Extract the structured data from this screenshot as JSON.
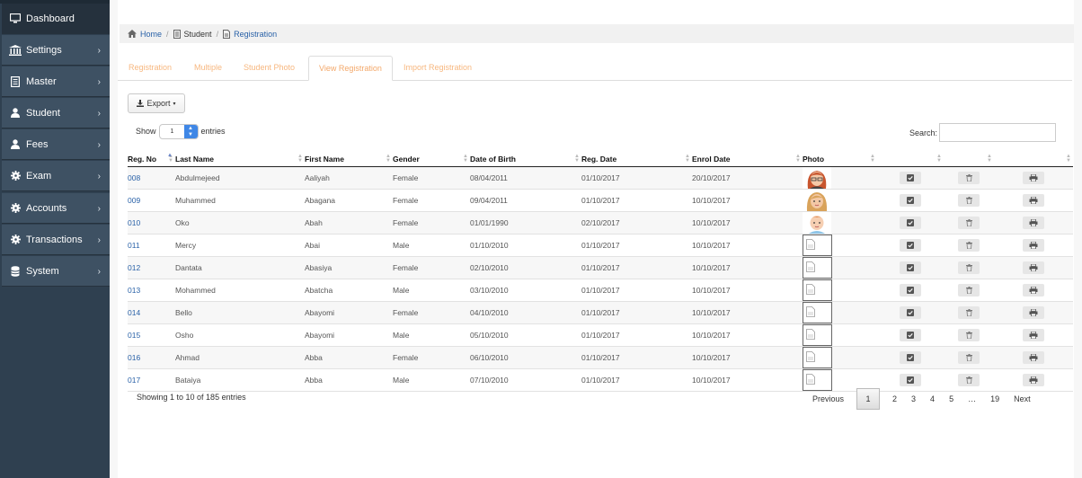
{
  "sidebar": {
    "items": [
      {
        "label": "Dashboard",
        "icon": "monitor-icon",
        "active": true
      },
      {
        "label": "Settings",
        "icon": "bank-icon"
      },
      {
        "label": "Master",
        "icon": "document-icon"
      },
      {
        "label": "Student",
        "icon": "user-icon"
      },
      {
        "label": "Fees",
        "icon": "users-icon"
      },
      {
        "label": "Exam",
        "icon": "gear-icon"
      },
      {
        "label": "Accounts",
        "icon": "gear-icon"
      },
      {
        "label": "Transactions",
        "icon": "gear-icon"
      },
      {
        "label": "System",
        "icon": "database-icon"
      }
    ]
  },
  "breadcrumb": {
    "home": "Home",
    "student": "Student",
    "registration": "Registration"
  },
  "tabs": [
    "Registration",
    "Multiple",
    "Student Photo",
    "View Registration",
    "Import Registration"
  ],
  "toolbar": {
    "export_label": "Export"
  },
  "length": {
    "show": "Show",
    "value": "1",
    "entries": "entries"
  },
  "search": {
    "label": "Search:",
    "value": ""
  },
  "table": {
    "columns": [
      "Reg. No",
      "Last Name",
      "First Name",
      "Gender",
      "Date of Birth",
      "Reg. Date",
      "Enrol Date",
      "Photo"
    ],
    "rows": [
      {
        "reg": "008",
        "last": "Abdulmejeed",
        "first": "Aaliyah",
        "gender": "Female",
        "dob": "08/04/2011",
        "regdate": "01/10/2017",
        "enrol": "20/10/2017",
        "photo": "avatar-red-hair"
      },
      {
        "reg": "009",
        "last": "Muhammed",
        "first": "Abagana",
        "gender": "Female",
        "dob": "09/04/2011",
        "regdate": "01/10/2017",
        "enrol": "10/10/2017",
        "photo": "avatar-blonde"
      },
      {
        "reg": "010",
        "last": "Oko",
        "first": "Abah",
        "gender": "Female",
        "dob": "01/01/1990",
        "regdate": "02/10/2017",
        "enrol": "10/10/2017",
        "photo": "avatar-boy"
      },
      {
        "reg": "011",
        "last": "Mercy",
        "first": "Abai",
        "gender": "Male",
        "dob": "01/10/2010",
        "regdate": "01/10/2017",
        "enrol": "10/10/2017",
        "photo": "none"
      },
      {
        "reg": "012",
        "last": "Dantata",
        "first": "Abasiya",
        "gender": "Female",
        "dob": "02/10/2010",
        "regdate": "01/10/2017",
        "enrol": "10/10/2017",
        "photo": "none"
      },
      {
        "reg": "013",
        "last": "Mohammed",
        "first": "Abatcha",
        "gender": "Male",
        "dob": "03/10/2010",
        "regdate": "01/10/2017",
        "enrol": "10/10/2017",
        "photo": "none"
      },
      {
        "reg": "014",
        "last": "Bello",
        "first": "Abayomi",
        "gender": "Female",
        "dob": "04/10/2010",
        "regdate": "01/10/2017",
        "enrol": "10/10/2017",
        "photo": "none"
      },
      {
        "reg": "015",
        "last": "Osho",
        "first": "Abayomi",
        "gender": "Male",
        "dob": "05/10/2010",
        "regdate": "01/10/2017",
        "enrol": "10/10/2017",
        "photo": "none"
      },
      {
        "reg": "016",
        "last": "Ahmad",
        "first": "Abba",
        "gender": "Female",
        "dob": "06/10/2010",
        "regdate": "01/10/2017",
        "enrol": "10/10/2017",
        "photo": "none"
      },
      {
        "reg": "017",
        "last": "Bataiya",
        "first": "Abba",
        "gender": "Male",
        "dob": "07/10/2010",
        "regdate": "01/10/2017",
        "enrol": "10/10/2017",
        "photo": "none"
      }
    ]
  },
  "info": "Showing 1 to 10 of 185 entries",
  "pagination": [
    "Previous",
    "1",
    "2",
    "3",
    "4",
    "5",
    "…",
    "19",
    "Next"
  ],
  "colors": {
    "sidebar": "#2f4050",
    "sidebar_item": "#3e5163",
    "link": "#2a62a8",
    "tab": "#f7b77f"
  }
}
